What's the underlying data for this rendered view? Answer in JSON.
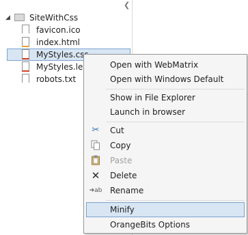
{
  "tree": {
    "root": {
      "label": "SiteWithCss"
    },
    "files": [
      {
        "label": "favicon.ico",
        "accent": "#ffffff"
      },
      {
        "label": "index.html",
        "accent": "#e8a33a"
      },
      {
        "label": "MyStyles.css",
        "accent": "#d0442a"
      },
      {
        "label": "MyStyles.less",
        "accent": "#d0442a"
      },
      {
        "label": "robots.txt",
        "accent": "#ffffff"
      }
    ]
  },
  "context_menu": {
    "open_with_webmatrix": "Open with WebMatrix",
    "open_with_windows_default": "Open with Windows Default",
    "show_in_file_explorer": "Show in File Explorer",
    "launch_in_browser": "Launch in browser",
    "cut": "Cut",
    "copy": "Copy",
    "paste": "Paste",
    "delete": "Delete",
    "rename": "Rename",
    "minify": "Minify",
    "orangebits_options": "OrangeBits Options"
  },
  "colors": {
    "selection_fill": "#d8e6f3",
    "selection_border": "#7da2ce",
    "menu_background": "#f5f5f5"
  }
}
